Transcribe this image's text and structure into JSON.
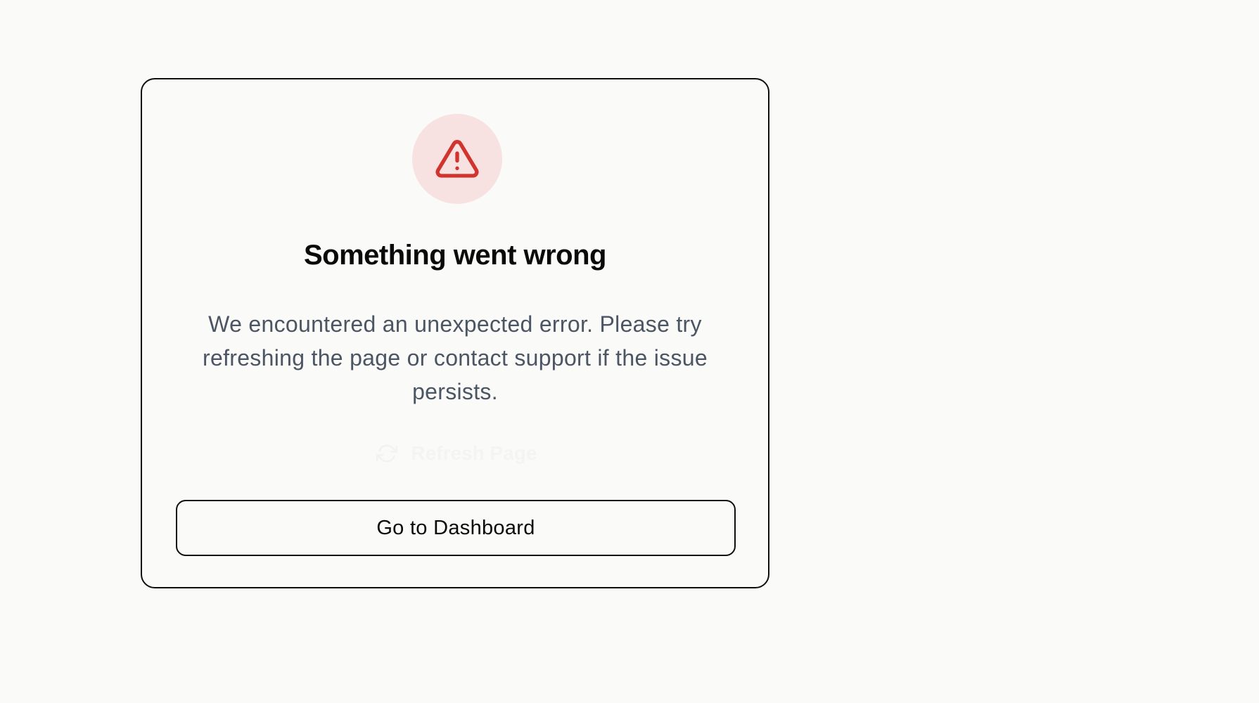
{
  "error": {
    "icon": "alert-triangle-icon",
    "title": "Something went wrong",
    "message": "We encountered an unexpected error. Please try refreshing the page or contact support if the issue persists."
  },
  "actions": {
    "refresh_icon": "refresh-icon",
    "refresh_label": "Refresh Page",
    "dashboard_label": "Go to Dashboard"
  },
  "colors": {
    "page_background": "#fafaf8",
    "icon_background": "#f8e1e1",
    "icon_accent": "#d0342c",
    "message_text": "#4b5563"
  }
}
